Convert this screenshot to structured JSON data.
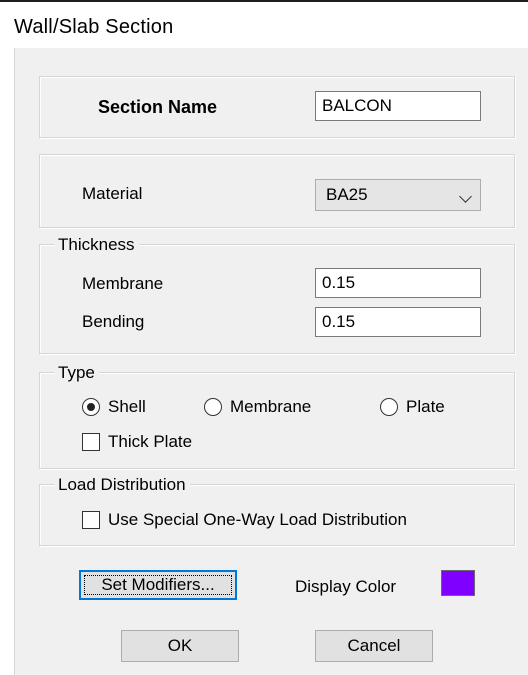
{
  "window": {
    "title": "Wall/Slab Section"
  },
  "section": {
    "label": "Section Name",
    "value": "BALCON"
  },
  "material": {
    "label": "Material",
    "selected": "BA25"
  },
  "thickness": {
    "group_title": "Thickness",
    "membrane_label": "Membrane",
    "membrane_value": "0.15",
    "bending_label": "Bending",
    "bending_value": "0.15"
  },
  "type": {
    "group_title": "Type",
    "options": [
      {
        "label": "Shell",
        "checked": true
      },
      {
        "label": "Membrane",
        "checked": false
      },
      {
        "label": "Plate",
        "checked": false
      }
    ],
    "thick_plate_label": "Thick Plate",
    "thick_plate_checked": false
  },
  "load_distribution": {
    "group_title": "Load Distribution",
    "checkbox_label": "Use Special One-Way Load Distribution",
    "checked": false
  },
  "modifiers": {
    "button_label": "Set Modifiers..."
  },
  "display_color": {
    "label": "Display Color",
    "color": "#8000ff"
  },
  "actions": {
    "ok_label": "OK",
    "cancel_label": "Cancel"
  }
}
